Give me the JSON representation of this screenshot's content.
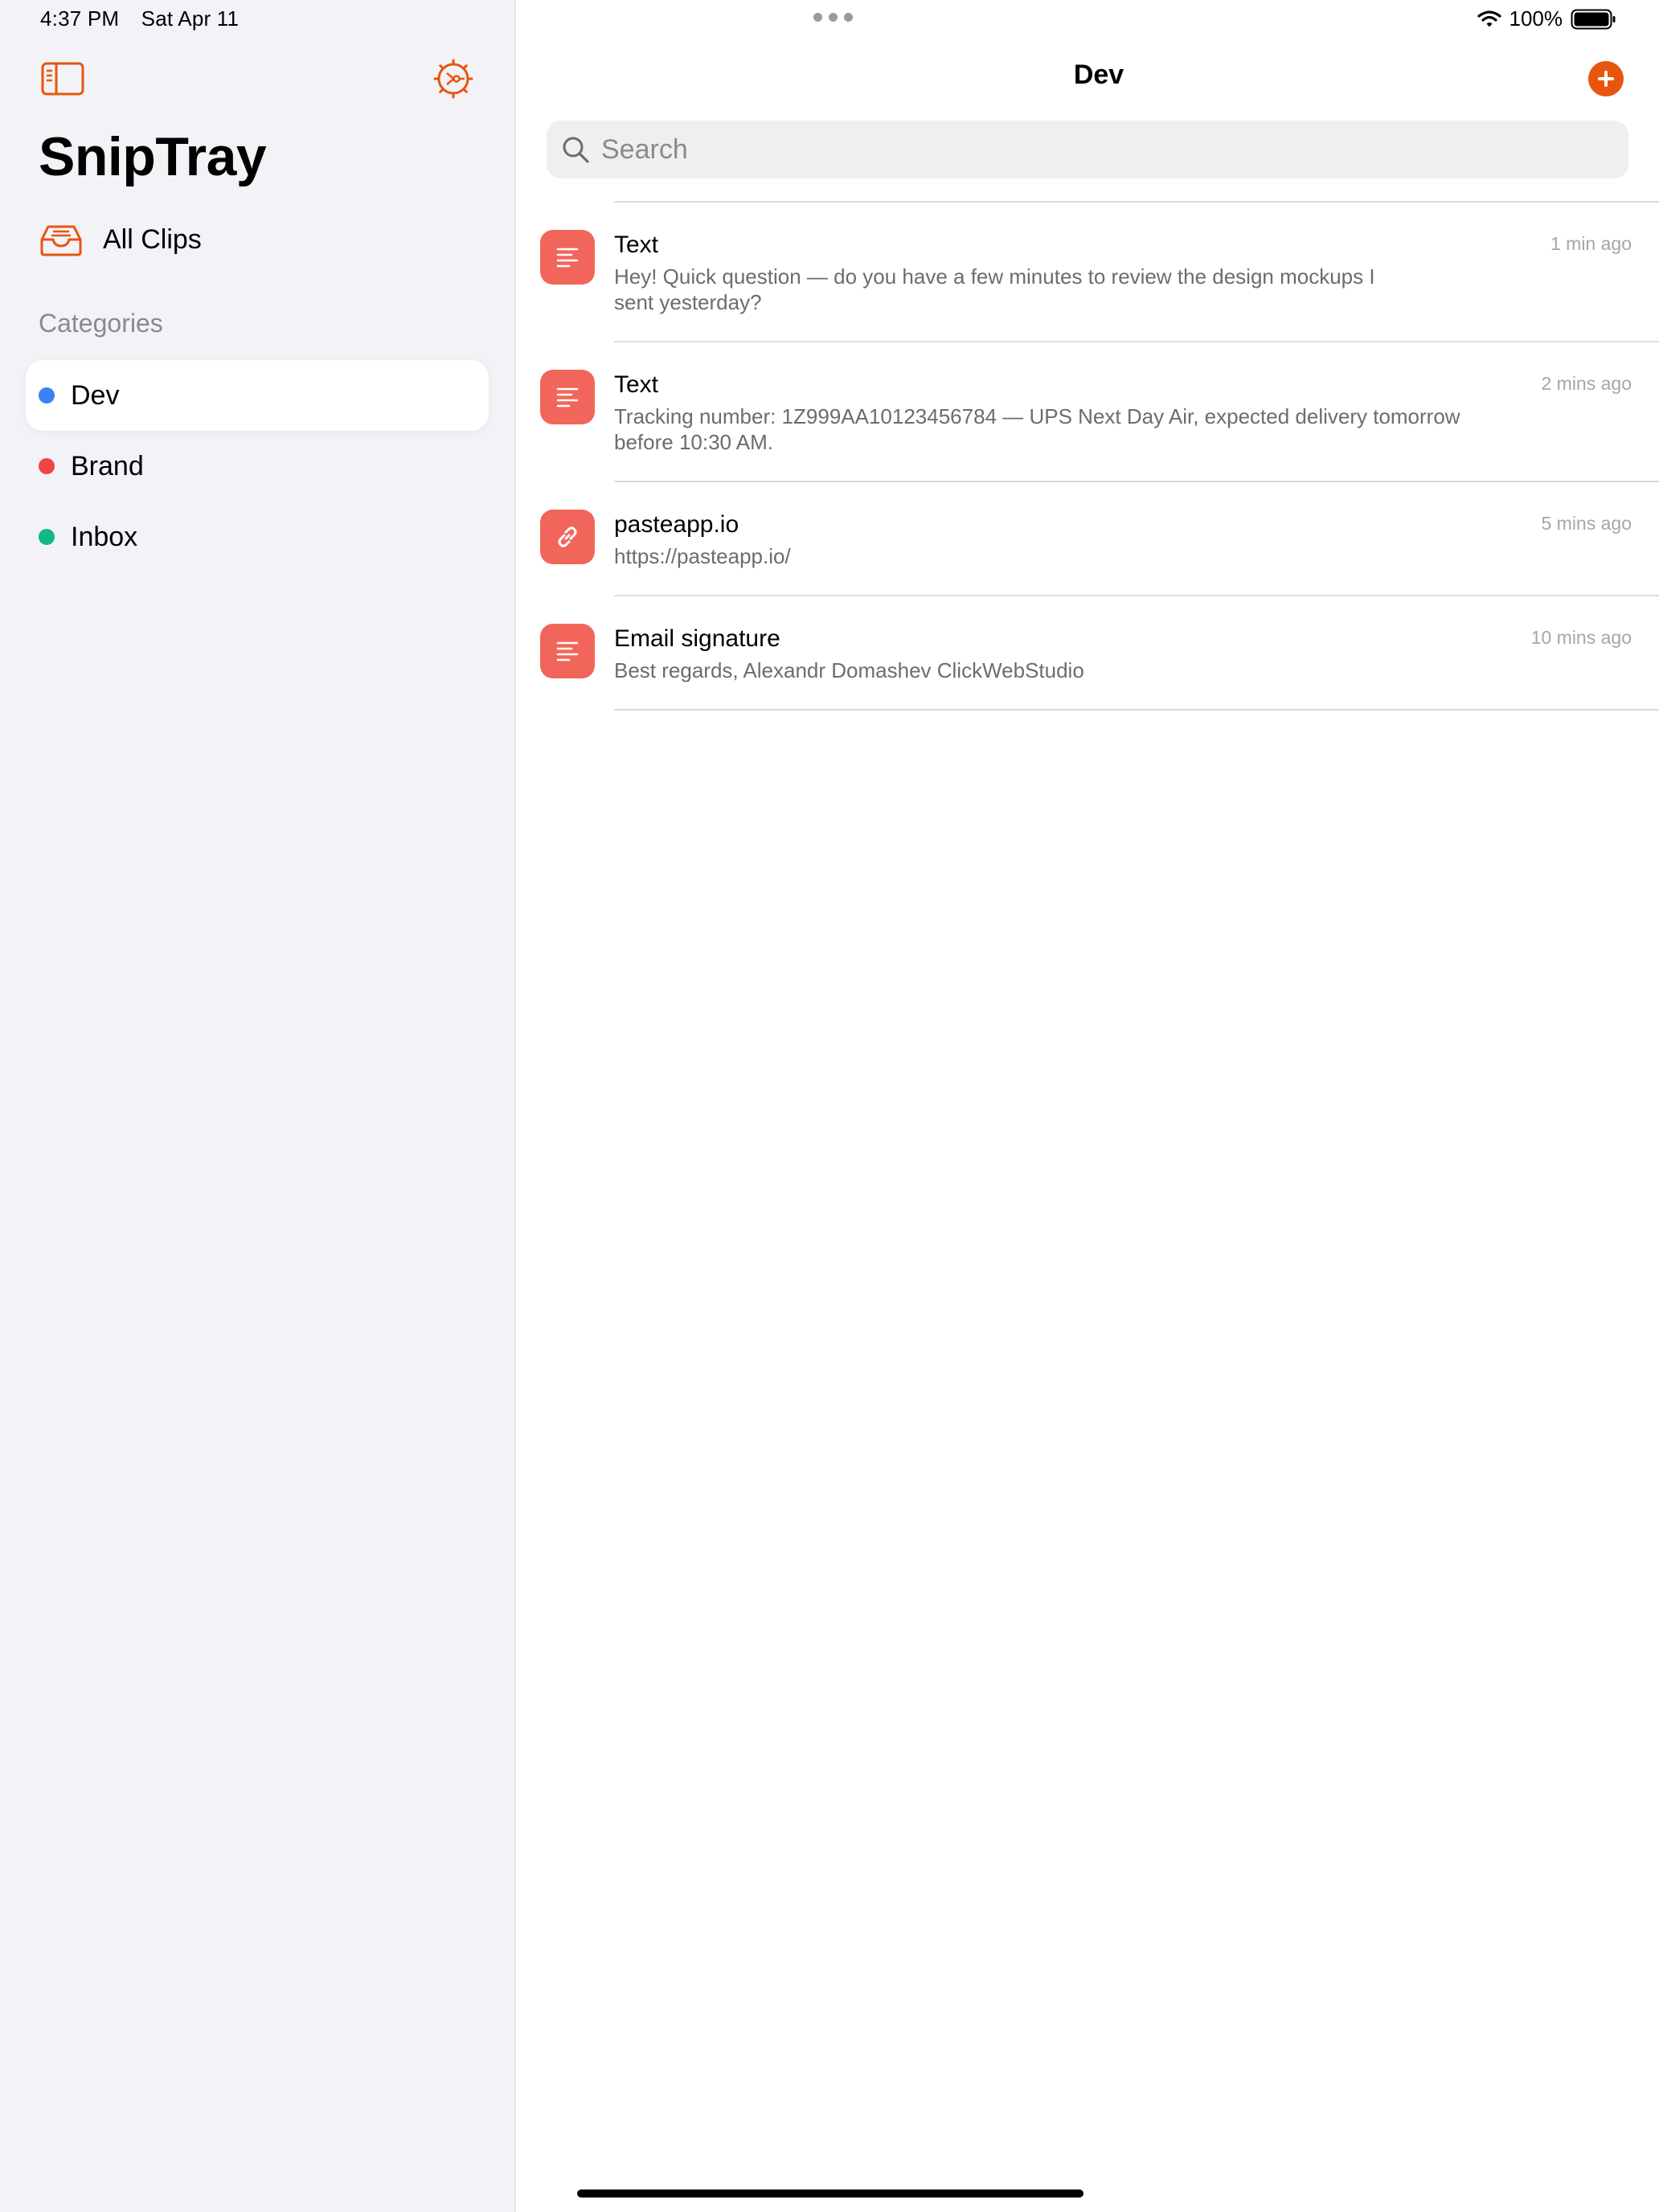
{
  "status": {
    "time": "4:37 PM",
    "date": "Sat Apr 11",
    "battery": "100%"
  },
  "sidebar": {
    "app_title": "SnipTray",
    "all_clips_label": "All Clips",
    "categories_heading": "Categories",
    "categories": [
      {
        "label": "Dev",
        "color": "#3b82f6",
        "selected": true
      },
      {
        "label": "Brand",
        "color": "#ef4444",
        "selected": false
      },
      {
        "label": "Inbox",
        "color": "#10b981",
        "selected": false
      }
    ]
  },
  "main": {
    "title": "Dev",
    "search_placeholder": "Search",
    "clips": [
      {
        "type_icon": "text-icon",
        "title": "Text",
        "sub_line1": "Hey! Quick question — do you have a few minutes to review the design mockups I",
        "sub_line2": "sent yesterday?",
        "time": "1 min ago"
      },
      {
        "type_icon": "text-icon",
        "title": "Text",
        "sub_line1": "Tracking number: 1Z999AA10123456784 — UPS Next Day Air, expected delivery tomorrow",
        "sub_line2": "before 10:30 AM.",
        "time": "2 mins ago"
      },
      {
        "type_icon": "link-icon",
        "title": "pasteapp.io",
        "sub_line1": "https://pasteapp.io/",
        "time": "5 mins ago"
      },
      {
        "type_icon": "text-icon",
        "title": "Email signature",
        "sub_line1": "Best regards, Alexandr Domashev ClickWebStudio",
        "time": "10 mins ago"
      }
    ]
  },
  "colors": {
    "accent": "#e8550e",
    "clip_icon_bg": "#f2655a",
    "sidebar_bg": "#f2f2f7"
  }
}
